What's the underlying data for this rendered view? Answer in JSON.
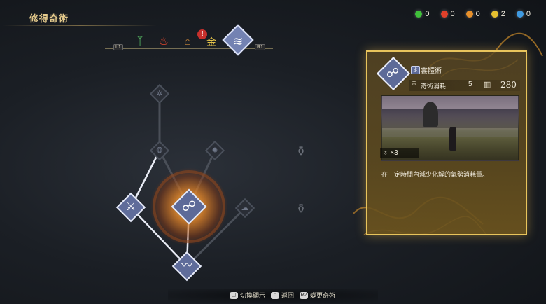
{
  "header": {
    "title": "修得奇術"
  },
  "resources": [
    {
      "icon": "green-gem-icon",
      "color": "#3fbf3a",
      "count": "0"
    },
    {
      "icon": "red-gem-icon",
      "color": "#e0402a",
      "count": "0"
    },
    {
      "icon": "orange-gem-icon",
      "color": "#e8902a",
      "count": "0"
    },
    {
      "icon": "gold-gem-icon",
      "color": "#e6c030",
      "count": "2"
    },
    {
      "icon": "blue-gem-icon",
      "color": "#3f9ae0",
      "count": "0"
    }
  ],
  "tabs": {
    "left_key": "L1",
    "right_key": "R1",
    "items": [
      {
        "icon": "wood-element-icon",
        "glyph": "ᛉ",
        "color": "#5fcf6c"
      },
      {
        "icon": "fire-element-icon",
        "glyph": "♨",
        "color": "#e0452c"
      },
      {
        "icon": "earth-element-icon",
        "glyph": "⌂",
        "color": "#d08a3a"
      },
      {
        "icon": "metal-element-icon",
        "glyph": "金",
        "color": "#e2c24a"
      },
      {
        "icon": "water-element-icon",
        "glyph": "≋",
        "color": "#ffffff",
        "active": true
      }
    ],
    "warning_badge": "!"
  },
  "detail": {
    "element_tag": "水",
    "skill_name": "雲體術",
    "cost_label": "奇術消耗",
    "cost_value": "5",
    "level_value": "280",
    "uses_value": "×3",
    "description": "在一定時間內減少化解的氣勢消耗量。"
  },
  "footer": {
    "hints": [
      {
        "button": "▢",
        "label": "切換顯示"
      },
      {
        "button": "○",
        "label": "返回"
      },
      {
        "button": "R2",
        "label": "變更奇術"
      }
    ]
  }
}
